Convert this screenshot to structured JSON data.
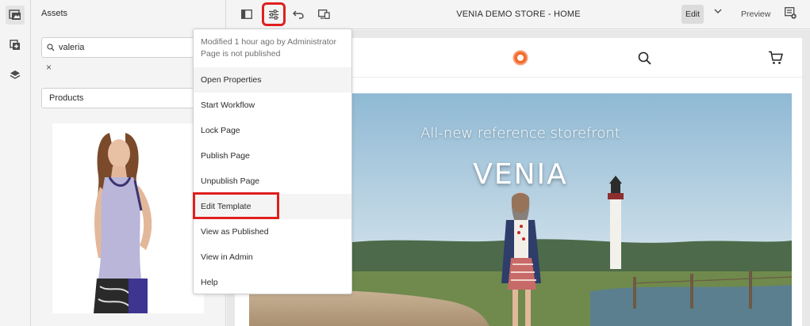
{
  "rail": {
    "items": [
      {
        "icon": "asset-browser-icon",
        "active": true
      },
      {
        "icon": "components-icon",
        "active": false
      },
      {
        "icon": "layers-icon",
        "active": false
      }
    ]
  },
  "assets_panel": {
    "title": "Assets",
    "search_value": "valeria",
    "clear_label": "×",
    "type_select": "Products"
  },
  "toolbar": {
    "page_title": "VENIA DEMO STORE - HOME",
    "edit_label": "Edit",
    "preview_label": "Preview"
  },
  "page_info_menu": {
    "info_line1": "Modified 1 hour ago by Administrator",
    "info_line2": "Page is not published",
    "items": [
      {
        "label": "Open Properties"
      },
      {
        "label": "Start Workflow"
      },
      {
        "label": "Lock Page"
      },
      {
        "label": "Publish Page"
      },
      {
        "label": "Unpublish Page"
      },
      {
        "label": "Edit Template"
      },
      {
        "label": "View as Published"
      },
      {
        "label": "View in Admin"
      },
      {
        "label": "Help"
      }
    ]
  },
  "hero": {
    "subtitle": "All-new reference storefront",
    "title": "VENIA"
  },
  "colors": {
    "highlight": "#e01f1f",
    "logo_orange": "#f26b2a"
  }
}
